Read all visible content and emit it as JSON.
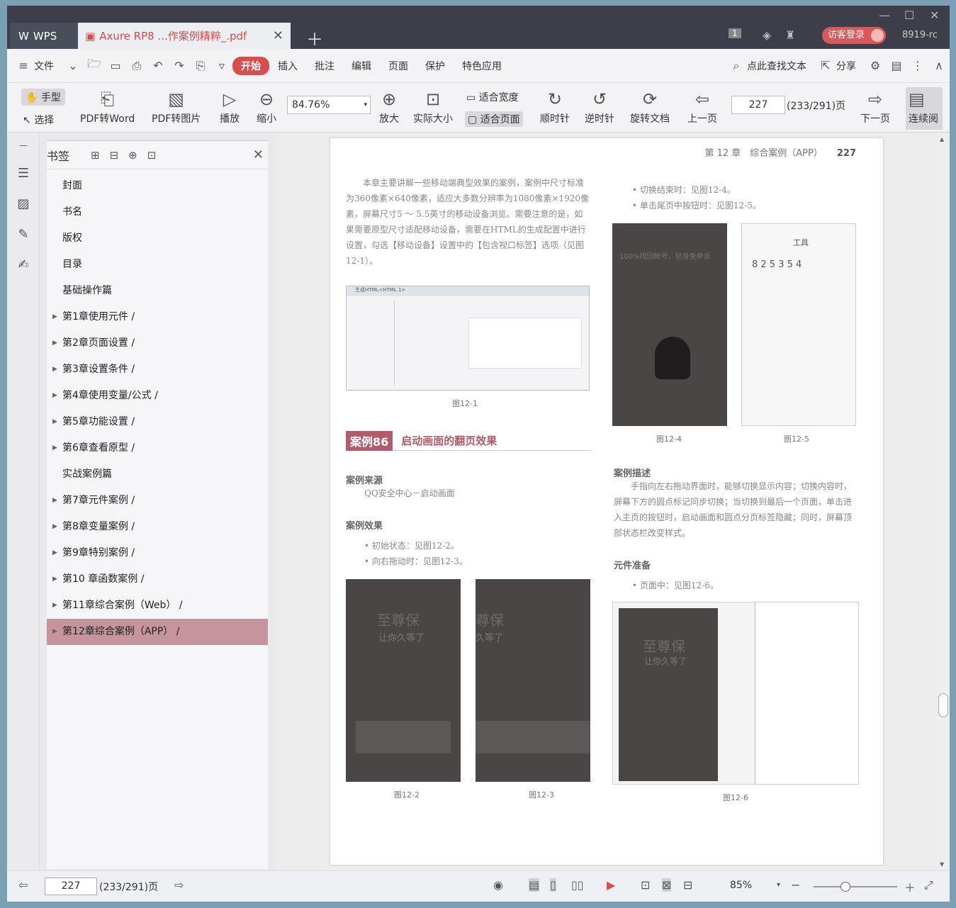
{
  "titlebar": {
    "app": "WPS",
    "doc_tab": "Axure RP8 ...作案例精粹_.pdf",
    "login": "访客登录",
    "version": "8919-rc",
    "page_badge": "1"
  },
  "menu": {
    "file": "文件",
    "items": [
      "开始",
      "插入",
      "批注",
      "编辑",
      "页面",
      "保护",
      "特色应用"
    ],
    "search": "点此查找文本",
    "share": "分享"
  },
  "toolbar": {
    "hand": "手型",
    "select": "选择",
    "pdf2word": "PDF转Word",
    "pdf2img": "PDF转图片",
    "play": "播放",
    "zoom_out": "缩小",
    "zoom": "84.76%",
    "zoom_in": "放大",
    "actual": "实际大小",
    "fit_width": "适合宽度",
    "fit_page": "适合页面",
    "cw": "顺时针",
    "ccw": "逆时针",
    "rotate": "旋转文档",
    "prev": "上一页",
    "page": "227",
    "total": "(233/291)页",
    "next": "下一页",
    "continuous": "连续阅"
  },
  "sidebar": {
    "title": "书签",
    "items": [
      {
        "label": "封面",
        "arrow": false
      },
      {
        "label": "书名",
        "arrow": false
      },
      {
        "label": "版权",
        "arrow": false
      },
      {
        "label": "目录",
        "arrow": false
      },
      {
        "label": "基础操作篇",
        "arrow": false
      },
      {
        "label": "第1章使用元件 /",
        "arrow": true
      },
      {
        "label": "第2章页面设置 /",
        "arrow": true
      },
      {
        "label": "第3章设置条件 /",
        "arrow": true
      },
      {
        "label": "第4章使用变量/公式 /",
        "arrow": true
      },
      {
        "label": "第5章功能设置 /",
        "arrow": true
      },
      {
        "label": "第6章查看原型 /",
        "arrow": true
      },
      {
        "label": "实战案例篇",
        "arrow": false
      },
      {
        "label": "第7章元件案例 /",
        "arrow": true
      },
      {
        "label": "第8章变量案例 /",
        "arrow": true
      },
      {
        "label": "第9章特别案例 /",
        "arrow": true
      },
      {
        "label": "第10 章函数案例 /",
        "arrow": true
      },
      {
        "label": "第11章综合案例（Web） /",
        "arrow": true
      },
      {
        "label": "第12章综合案例（APP） /",
        "arrow": true,
        "selected": true
      }
    ]
  },
  "pdf": {
    "header": "第 12 章　综合案例（APP）",
    "page_no": "227",
    "intro": "本章主要讲解一些移动端典型效果的案例，案例中尺寸标准为360像素×640像素，适应大多数分辨率为1080像素×1920像素，屏幕尺寸5 ～ 5.5英寸的移动设备浏览。需要注意的是，如果需要原型尺寸适配移动设备，需要在HTML的生成配置中进行设置，勾选【移动设备】设置中的【包含视口标签】选项（见图12-1）。",
    "dialog_title": "生成HTML<HTML 1>",
    "fig1": "图12-1",
    "case_no": "案例86",
    "case_title": "启动画面的翻页效果",
    "src_h": "案例来源",
    "src": "QQ安全中心－启动画面",
    "eff_h": "案例效果",
    "eff1": "初始状态：见图12-2。",
    "eff2": "向右拖动时：见图12-3。",
    "fig2": "图12-2",
    "fig3": "图12-3",
    "r1": "切换结束时：见图12-4。",
    "r2": "单击尾页中按钮时：见图12-5。",
    "fig4": "图12-4",
    "fig5": "图12-5",
    "desc_h": "案例描述",
    "desc": "手指向左右拖动界面时，能够切换显示内容；切换内容时，屏幕下方的圆点标记同步切换；当切换到最后一个页面，单击进入主页的按钮时，启动画面和圆点分页标签隐藏；同时，屏幕顶部状态栏改变样式。",
    "prep_h": "元件准备",
    "prep": "页面中：见图12-6。",
    "fig6": "图12-6",
    "phone_big1": "至尊保",
    "phone_sub1": "让你久等了",
    "phone_big2": "尊保",
    "phone_sub2": "久等了",
    "phone_big3": "100%找回帐号，轻身免申诉",
    "tool_title": "工具",
    "code": "8 2 5 3 5 4"
  },
  "status": {
    "page": "227",
    "total": "(233/291)页",
    "zoom": "85%"
  }
}
